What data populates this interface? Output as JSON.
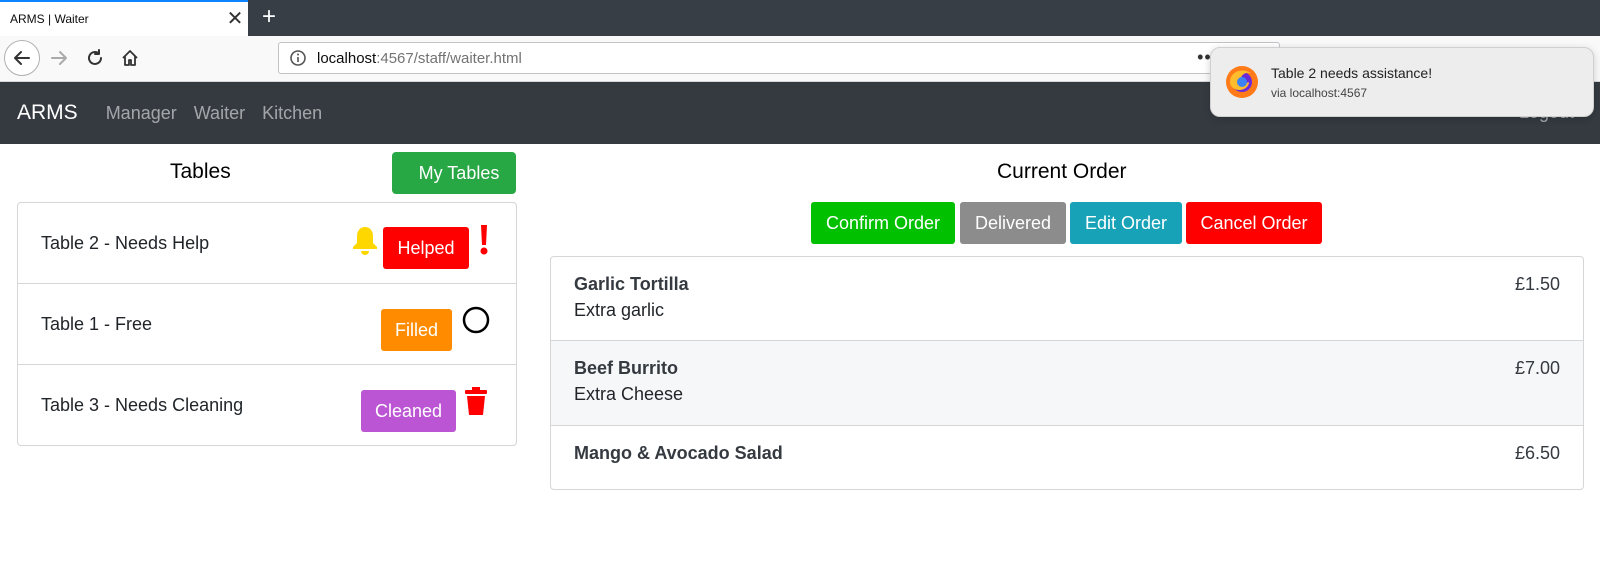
{
  "browser": {
    "tab_title": "ARMS | Waiter",
    "tab_close": "✕",
    "new_tab": "+",
    "url_host": "localhost",
    "url_rest": ":4567/staff/waiter.html",
    "url_menu": "•••"
  },
  "notification": {
    "title": "Table 2 needs assistance!",
    "source": "via localhost:4567"
  },
  "navbar": {
    "brand": "ARMS",
    "links": [
      "Manager",
      "Waiter",
      "Kitchen"
    ],
    "logout": "Logout"
  },
  "tables": {
    "heading": "Tables",
    "my_tables_label": "My Tables",
    "items": [
      {
        "label": "Table 2 - Needs Help",
        "action": "Helped",
        "status_icon": "exclamation-icon",
        "alert_icon": "bell-icon"
      },
      {
        "label": "Table 1 - Free",
        "action": "Filled",
        "status_icon": "circle-icon"
      },
      {
        "label": "Table 3 - Needs Cleaning",
        "action": "Cleaned",
        "status_icon": "trash-icon"
      }
    ]
  },
  "order": {
    "heading": "Current Order",
    "buttons": {
      "confirm": "Confirm Order",
      "delivered": "Delivered",
      "edit": "Edit Order",
      "cancel": "Cancel Order"
    },
    "items": [
      {
        "name": "Garlic Tortilla",
        "note": "Extra garlic",
        "price": "£1.50"
      },
      {
        "name": "Beef Burrito",
        "note": "Extra Cheese",
        "price": "£7.00"
      },
      {
        "name": "Mango & Avocado Salad",
        "note": "",
        "price": "£6.50"
      }
    ]
  },
  "colors": {
    "navbar": "#343a40",
    "success": "#28a745",
    "confirm": "#00c000",
    "danger": "#ff0000",
    "filled": "#ff8c00",
    "cleaned": "#bb55d3",
    "edit": "#17a2b8",
    "delivered": "#8c8c8c",
    "bell": "#ffd700"
  }
}
